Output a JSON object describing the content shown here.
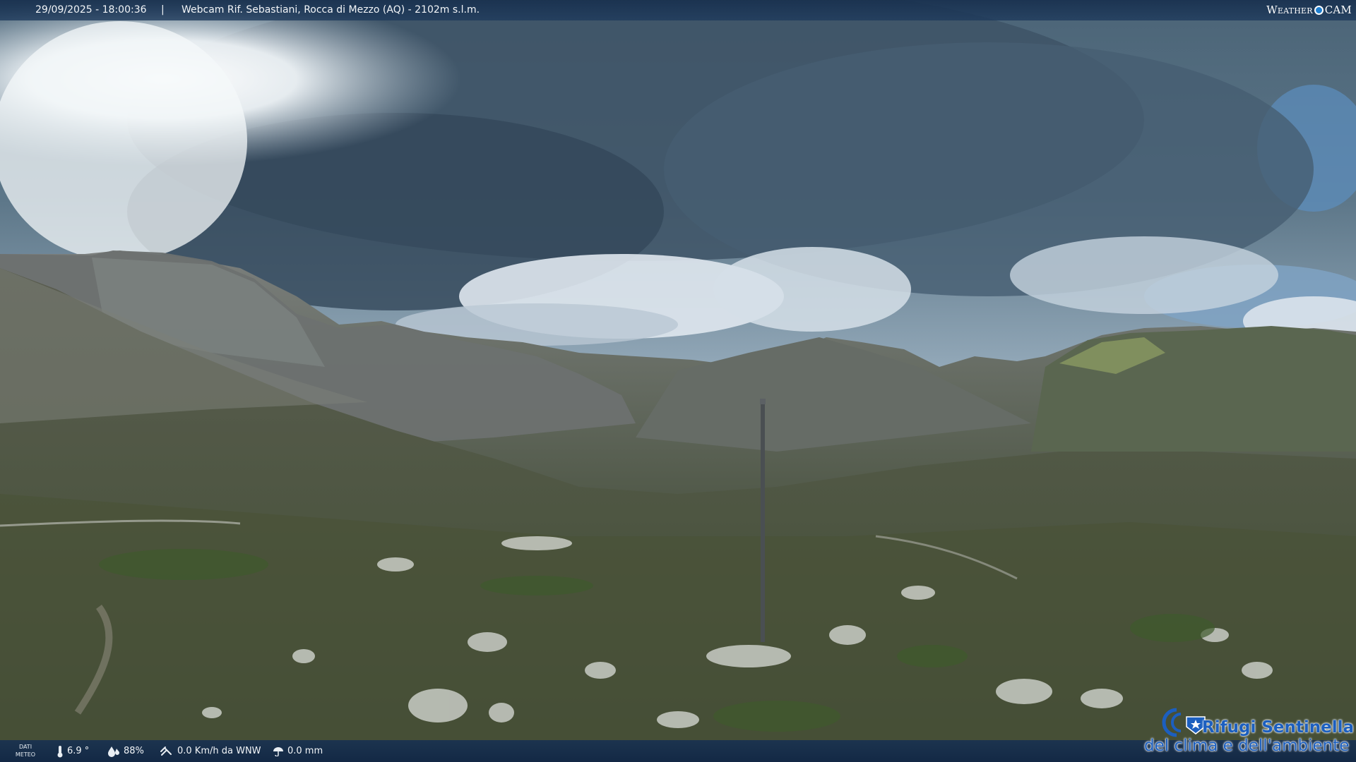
{
  "overlay": {
    "timestamp": "29/09/2025 - 18:00:36",
    "separator": "|",
    "camera_title": "Webcam Rif. Sebastiani, Rocca di Mezzo (AQ) - 2102m s.l.m.",
    "brand_weather": "Weather",
    "brand_cam": "CAM"
  },
  "weather": {
    "label": "DATI METEO",
    "temperature": "6.9 °",
    "humidity": "88%",
    "wind": "0.0 Km/h da WNW",
    "rain": "0.0 mm"
  },
  "logo": {
    "line1": "Rifugi Sentinella",
    "line2": "del clima e dell'ambiente"
  },
  "icons": [
    "thermometer-icon",
    "humidity-icon",
    "wind-icon",
    "rain-icon",
    "rifugi-emblem-icon"
  ],
  "colors": {
    "bar": "#1e3a5c",
    "logo_blue": "#1c5fbf"
  }
}
